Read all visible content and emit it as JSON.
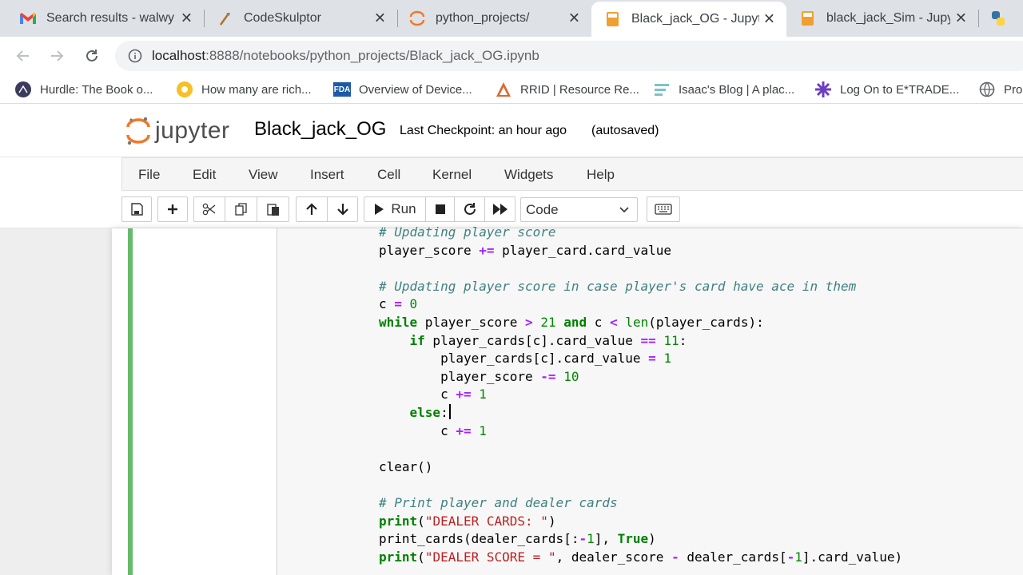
{
  "browser": {
    "tabs": [
      {
        "title": "Search results - walwy",
        "icon": "gmail-icon",
        "active": false
      },
      {
        "title": "CodeSkulptor",
        "icon": "codeskulptor-icon",
        "active": false
      },
      {
        "title": "python_projects/",
        "icon": "jupyter-icon",
        "active": false
      },
      {
        "title": "Black_jack_OG - Jupyte",
        "icon": "notebook-icon",
        "active": true
      },
      {
        "title": "black_jack_Sim - Jupyt",
        "icon": "notebook-icon",
        "active": false
      }
    ],
    "close_glyph": "✕",
    "url_host": "localhost",
    "url_path": ":8888/notebooks/python_projects/Black_jack_OG.ipynb",
    "bookmarks": [
      {
        "label": "Hurdle: The Book o...",
        "icon": "hurdle-icon"
      },
      {
        "label": "How many are rich...",
        "icon": "yellow-circle-icon"
      },
      {
        "label": "Overview of Device...",
        "icon": "fda-icon"
      },
      {
        "label": "RRID | Resource Re...",
        "icon": "rrid-icon"
      },
      {
        "label": "Isaac's Blog | A plac...",
        "icon": "blog-icon"
      },
      {
        "label": "Log On to E*TRADE...",
        "icon": "etrade-icon"
      },
      {
        "label": "Pro",
        "icon": "globe-icon"
      }
    ],
    "fda_text": "FDA"
  },
  "jupyter": {
    "wordmark": "jupyter",
    "notebook_name": "Black_jack_OG",
    "checkpoint": "Last Checkpoint: an hour ago",
    "autosave": "(autosaved)",
    "menu": [
      "File",
      "Edit",
      "View",
      "Insert",
      "Cell",
      "Kernel",
      "Widgets",
      "Help"
    ],
    "run_label": "Run",
    "cell_type": "Code"
  },
  "code_lines": [
    [
      [
        "cm",
        "# Updating player score"
      ]
    ],
    [
      [
        "plain",
        "player_score "
      ],
      [
        "op",
        "+="
      ],
      [
        "plain",
        " player_card.card_value"
      ]
    ],
    [],
    [
      [
        "cm",
        "# Updating player score in case player's card have ace in them"
      ]
    ],
    [
      [
        "plain",
        "c "
      ],
      [
        "op",
        "="
      ],
      [
        "plain",
        " "
      ],
      [
        "num",
        "0"
      ]
    ],
    [
      [
        "kw",
        "while"
      ],
      [
        "plain",
        " player_score "
      ],
      [
        "op",
        ">"
      ],
      [
        "plain",
        " "
      ],
      [
        "num",
        "21"
      ],
      [
        "plain",
        " "
      ],
      [
        "kw",
        "and"
      ],
      [
        "plain",
        " c "
      ],
      [
        "op",
        "<"
      ],
      [
        "plain",
        " "
      ],
      [
        "bi",
        "len"
      ],
      [
        "plain",
        "(player_cards):"
      ]
    ],
    [
      [
        "plain",
        "    "
      ],
      [
        "kw",
        "if"
      ],
      [
        "plain",
        " player_cards[c].card_value "
      ],
      [
        "op",
        "=="
      ],
      [
        "plain",
        " "
      ],
      [
        "num",
        "11"
      ],
      [
        "plain",
        ":"
      ]
    ],
    [
      [
        "plain",
        "        player_cards[c].card_value "
      ],
      [
        "op",
        "="
      ],
      [
        "plain",
        " "
      ],
      [
        "num",
        "1"
      ]
    ],
    [
      [
        "plain",
        "        player_score "
      ],
      [
        "op",
        "-="
      ],
      [
        "plain",
        " "
      ],
      [
        "num",
        "10"
      ]
    ],
    [
      [
        "plain",
        "        c "
      ],
      [
        "op",
        "+="
      ],
      [
        "plain",
        " "
      ],
      [
        "num",
        "1"
      ]
    ],
    [
      [
        "plain",
        "    "
      ],
      [
        "kw",
        "else"
      ],
      [
        "plain",
        ":"
      ],
      [
        "cursor",
        ""
      ]
    ],
    [
      [
        "plain",
        "        c "
      ],
      [
        "op",
        "+="
      ],
      [
        "plain",
        " "
      ],
      [
        "num",
        "1"
      ]
    ],
    [],
    [
      [
        "plain",
        "clear()"
      ]
    ],
    [],
    [
      [
        "cm",
        "# Print player and dealer cards"
      ]
    ],
    [
      [
        "kw",
        "print"
      ],
      [
        "plain",
        "("
      ],
      [
        "str",
        "\"DEALER CARDS: \""
      ],
      [
        "plain",
        ")"
      ]
    ],
    [
      [
        "plain",
        "print_cards(dealer_cards[:"
      ],
      [
        "op",
        "-"
      ],
      [
        "num",
        "1"
      ],
      [
        "plain",
        "], "
      ],
      [
        "kw",
        "True"
      ],
      [
        "plain",
        ")"
      ]
    ],
    [
      [
        "kw",
        "print"
      ],
      [
        "plain",
        "("
      ],
      [
        "str",
        "\"DEALER SCORE = \""
      ],
      [
        "plain",
        ", dealer_score "
      ],
      [
        "op",
        "-"
      ],
      [
        "plain",
        " dealer_cards["
      ],
      [
        "op",
        "-"
      ],
      [
        "num",
        "1"
      ],
      [
        "plain",
        "].card_value)"
      ]
    ]
  ]
}
